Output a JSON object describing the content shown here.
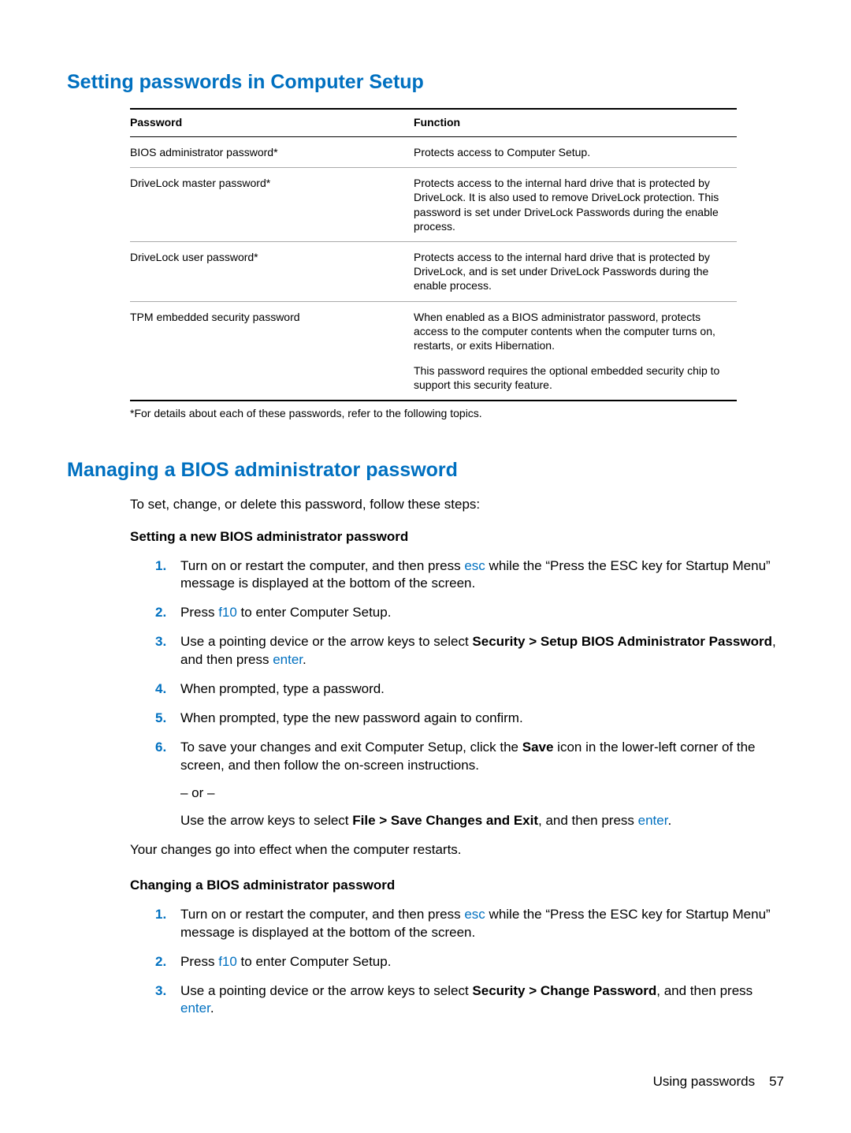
{
  "heading1": "Setting passwords in Computer Setup",
  "table": {
    "head_password": "Password",
    "head_function": "Function",
    "rows": [
      {
        "p": "BIOS administrator password*",
        "f": "Protects access to Computer Setup."
      },
      {
        "p": "DriveLock master password*",
        "f": "Protects access to the internal hard drive that is protected by DriveLock. It is also used to remove DriveLock protection. This password is set under DriveLock Passwords during the enable process."
      },
      {
        "p": "DriveLock user password*",
        "f": "Protects access to the internal hard drive that is protected by DriveLock, and is set under DriveLock Passwords during the enable process."
      },
      {
        "p": "TPM embedded security password",
        "f": "When enabled as a BIOS administrator password, protects access to the computer contents when the computer turns on, restarts, or exits Hibernation.",
        "f2": "This password requires the optional embedded security chip to support this security feature."
      }
    ]
  },
  "footnote": "*For details about each of these passwords, refer to the following topics.",
  "heading2": "Managing a BIOS administrator password",
  "intro2": "To set, change, or delete this password, follow these steps:",
  "subA": "Setting a new BIOS administrator password",
  "subB": "Changing a BIOS administrator password",
  "stepsA": {
    "s1a": "Turn on or restart the computer, and then press ",
    "s1k": "esc",
    "s1b": " while the “Press the ESC key for Startup Menu” message is displayed at the bottom of the screen.",
    "s2a": "Press ",
    "s2k": "f10",
    "s2b": " to enter Computer Setup.",
    "s3a": "Use a pointing device or the arrow keys to select ",
    "s3bold": "Security > Setup BIOS Administrator Password",
    "s3b": ", and then press ",
    "s3k": "enter",
    "s3c": ".",
    "s4": "When prompted, type a password.",
    "s5": "When prompted, type the new password again to confirm.",
    "s6a": "To save your changes and exit Computer Setup, click the ",
    "s6bold1": "Save",
    "s6b": " icon in the lower-left corner of the screen, and then follow the on-screen instructions.",
    "s6or": "– or –",
    "s6c": "Use the arrow keys to select ",
    "s6bold2": "File > Save Changes and Exit",
    "s6d": ", and then press ",
    "s6k": "enter",
    "s6e": "."
  },
  "result": "Your changes go into effect when the computer restarts.",
  "stepsB": {
    "s1a": "Turn on or restart the computer, and then press ",
    "s1k": "esc",
    "s1b": " while the “Press the ESC key for Startup Menu” message is displayed at the bottom of the screen.",
    "s2a": "Press ",
    "s2k": "f10",
    "s2b": " to enter Computer Setup.",
    "s3a": "Use a pointing device or the arrow keys to select ",
    "s3bold": "Security > Change Password",
    "s3b": ", and then press ",
    "s3k": "enter",
    "s3c": "."
  },
  "footer_label": "Using passwords",
  "footer_page": "57"
}
